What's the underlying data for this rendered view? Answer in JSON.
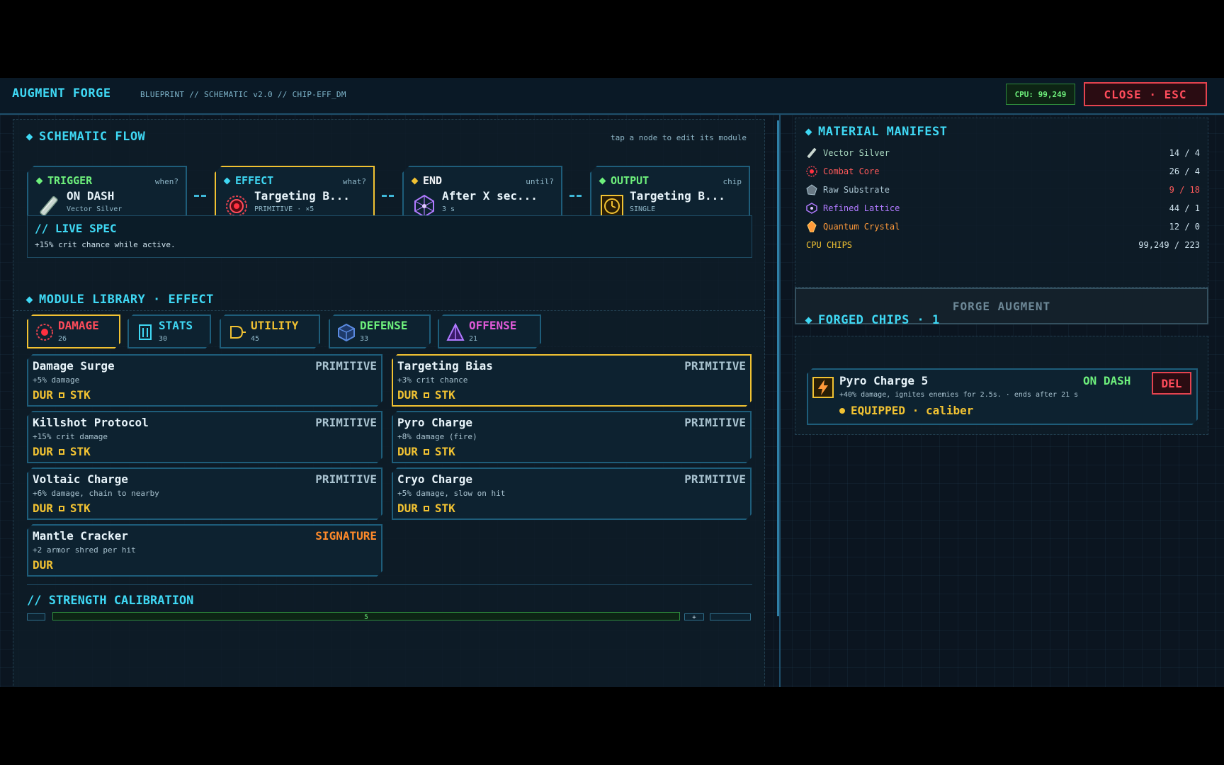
{
  "header": {
    "title": "AUGMENT FORGE",
    "subtitle": "BLUEPRINT // SCHEMATIC v2.0 // CHIP-EFF_DM",
    "cpu": "CPU: 99,249",
    "close": "CLOSE · ESC"
  },
  "flow": {
    "title": "SCHEMATIC FLOW",
    "hint": "tap a node to edit its module",
    "nodes": [
      {
        "label": "TRIGGER",
        "question": "when?",
        "main": "ON DASH",
        "sub": "Vector Silver",
        "color": "#6ef07c",
        "icon": "vector-silver-icon"
      },
      {
        "label": "EFFECT",
        "question": "what?",
        "main": "Targeting B...",
        "sub": "PRIMITIVE · ×5",
        "color": "#3fd8f4",
        "icon": "combat-core-icon"
      },
      {
        "label": "END",
        "question": "until?",
        "main": "After X sec...",
        "sub": "3 s",
        "color": "#f1c232",
        "icon": "refined-lattice-icon"
      },
      {
        "label": "OUTPUT",
        "question": "chip",
        "main": "Targeting B...",
        "sub": "SINGLE",
        "color": "#6ef07c",
        "icon": "clock-chip-icon"
      }
    ],
    "live_spec_title": "// LIVE SPEC",
    "live_spec_text": "+15% crit chance while active."
  },
  "library": {
    "title": "MODULE LIBRARY · EFFECT",
    "tabs": [
      {
        "label": "DAMAGE",
        "count": "26",
        "color": "#ff4c5b",
        "icon": "damage-icon"
      },
      {
        "label": "STATS",
        "count": "30",
        "color": "#3fd8f4",
        "icon": "stats-icon"
      },
      {
        "label": "UTILITY",
        "count": "45",
        "color": "#f1c232",
        "icon": "utility-icon"
      },
      {
        "label": "DEFENSE",
        "count": "33",
        "color": "#6ef07c",
        "icon": "defense-icon"
      },
      {
        "label": "OFFENSE",
        "count": "21",
        "color": "#e05ad8",
        "icon": "offense-icon"
      }
    ],
    "modules": [
      {
        "name": "Damage Surge",
        "tier": "PRIMITIVE",
        "desc": "+5% damage",
        "tag1": "DUR",
        "tag2": "STK"
      },
      {
        "name": "Targeting Bias",
        "tier": "PRIMITIVE",
        "desc": "+3% crit chance",
        "tag1": "DUR",
        "tag2": "STK"
      },
      {
        "name": "Killshot Protocol",
        "tier": "PRIMITIVE",
        "desc": "+15% crit damage",
        "tag1": "DUR",
        "tag2": "STK"
      },
      {
        "name": "Pyro Charge",
        "tier": "PRIMITIVE",
        "desc": "+8% damage (fire)",
        "tag1": "DUR",
        "tag2": "STK"
      },
      {
        "name": "Voltaic Charge",
        "tier": "PRIMITIVE",
        "desc": "+6% damage, chain to nearby",
        "tag1": "DUR",
        "tag2": "STK"
      },
      {
        "name": "Cryo Charge",
        "tier": "PRIMITIVE",
        "desc": "+5% damage, slow on hit",
        "tag1": "DUR",
        "tag2": "STK"
      },
      {
        "name": "Mantle Cracker",
        "tier": "SIGNATURE",
        "desc": "+2 armor shred per hit",
        "tag1": "DUR"
      }
    ]
  },
  "calibration": {
    "title": "// STRENGTH CALIBRATION",
    "value": "5",
    "plus": "+"
  },
  "manifest": {
    "title": "MATERIAL MANIFEST",
    "materials": [
      {
        "name": "Vector Silver",
        "qty": "14 / 4",
        "color": "#a9d8c0",
        "qty_color": "#cfe3ee",
        "icon": "vector-silver-icon"
      },
      {
        "name": "Combat Core",
        "qty": "26 / 4",
        "color": "#ff5a5a",
        "qty_color": "#cfe3ee",
        "icon": "combat-core-icon"
      },
      {
        "name": "Raw Substrate",
        "qty": "9 / 18",
        "color": "#a9c3d0",
        "qty_color": "#ff5a5a",
        "icon": "raw-substrate-icon"
      },
      {
        "name": "Refined Lattice",
        "qty": "44 / 1",
        "color": "#b07aff",
        "qty_color": "#cfe3ee",
        "icon": "refined-lattice-icon"
      },
      {
        "name": "Quantum Crystal",
        "qty": "12 / 0",
        "color": "#ff9a3a",
        "qty_color": "#cfe3ee",
        "icon": "quantum-crystal-icon"
      }
    ],
    "cpu_label": "CPU CHIPS",
    "cpu_qty": "99,249 / 223"
  },
  "forge_button": "FORGE AUGMENT",
  "forged": {
    "title": "FORGED CHIPS · 1",
    "chip_name": "Pyro Charge 5",
    "chip_trigger": "ON DASH",
    "chip_desc": "+40% damage, ignites enemies for 2.5s. · ends after 21 s",
    "chip_status": "EQUIPPED · caliber",
    "delete": "DEL"
  }
}
